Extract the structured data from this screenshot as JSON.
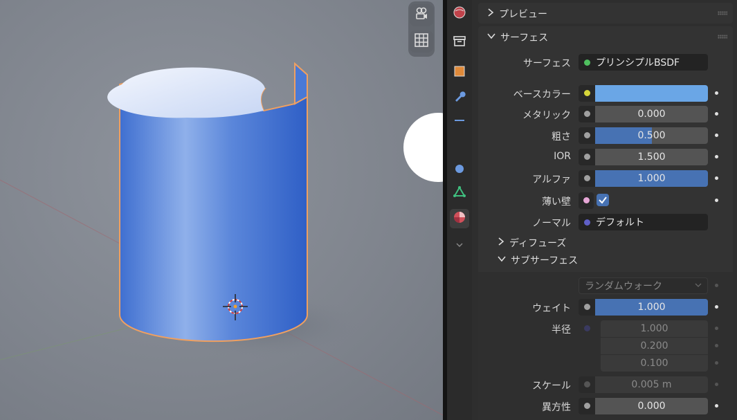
{
  "viewport": {
    "object": "cylinder-open-seam",
    "icons": [
      "camera-icon",
      "grid-icon"
    ]
  },
  "tabs": [
    "world-icon",
    "object-data-icon",
    "object-icon",
    "wrench-icon",
    "particles-icon",
    "physics-icon",
    "data-icon",
    "material-icon",
    "chevron-down-icon"
  ],
  "callout": {
    "points_to": "thin-wall-checkbox"
  },
  "panels": {
    "preview": {
      "label": "プレビュー"
    },
    "surface": {
      "label": "サーフェス"
    }
  },
  "surface": {
    "shader_label": "サーフェス",
    "shader_value": "プリンシプルBSDF",
    "base_color": {
      "label": "ベースカラー",
      "color": "#6aa6e6"
    },
    "metallic": {
      "label": "メタリック",
      "value": "0.000",
      "fill": 0.0
    },
    "roughness": {
      "label": "粗さ",
      "value": "0.500",
      "fill": 0.5
    },
    "ior": {
      "label": "IOR",
      "value": "1.500",
      "fill": 0.0
    },
    "alpha": {
      "label": "アルファ",
      "value": "1.000",
      "fill": 1.0
    },
    "thin_wall": {
      "label": "薄い壁",
      "checked": true
    },
    "normal": {
      "label": "ノーマル",
      "value": "デフォルト"
    }
  },
  "subpanels": {
    "diffuse": {
      "label": "ディフューズ"
    },
    "subsurface": {
      "label": "サブサーフェス"
    }
  },
  "subsurface": {
    "method": "ランダムウォーク",
    "weight": {
      "label": "ウェイト",
      "value": "1.000",
      "fill": 1.0
    },
    "radius": {
      "label": "半径",
      "values": [
        "1.000",
        "0.200",
        "0.100"
      ]
    },
    "scale": {
      "label": "スケール",
      "value": "0.005 m"
    },
    "anisotropy": {
      "label": "異方性",
      "value": "0.000",
      "fill": 0.0
    }
  },
  "colors": {
    "accent": "#4772b3",
    "selection_outline": "#f0a060",
    "panel_bg": "#333333"
  }
}
